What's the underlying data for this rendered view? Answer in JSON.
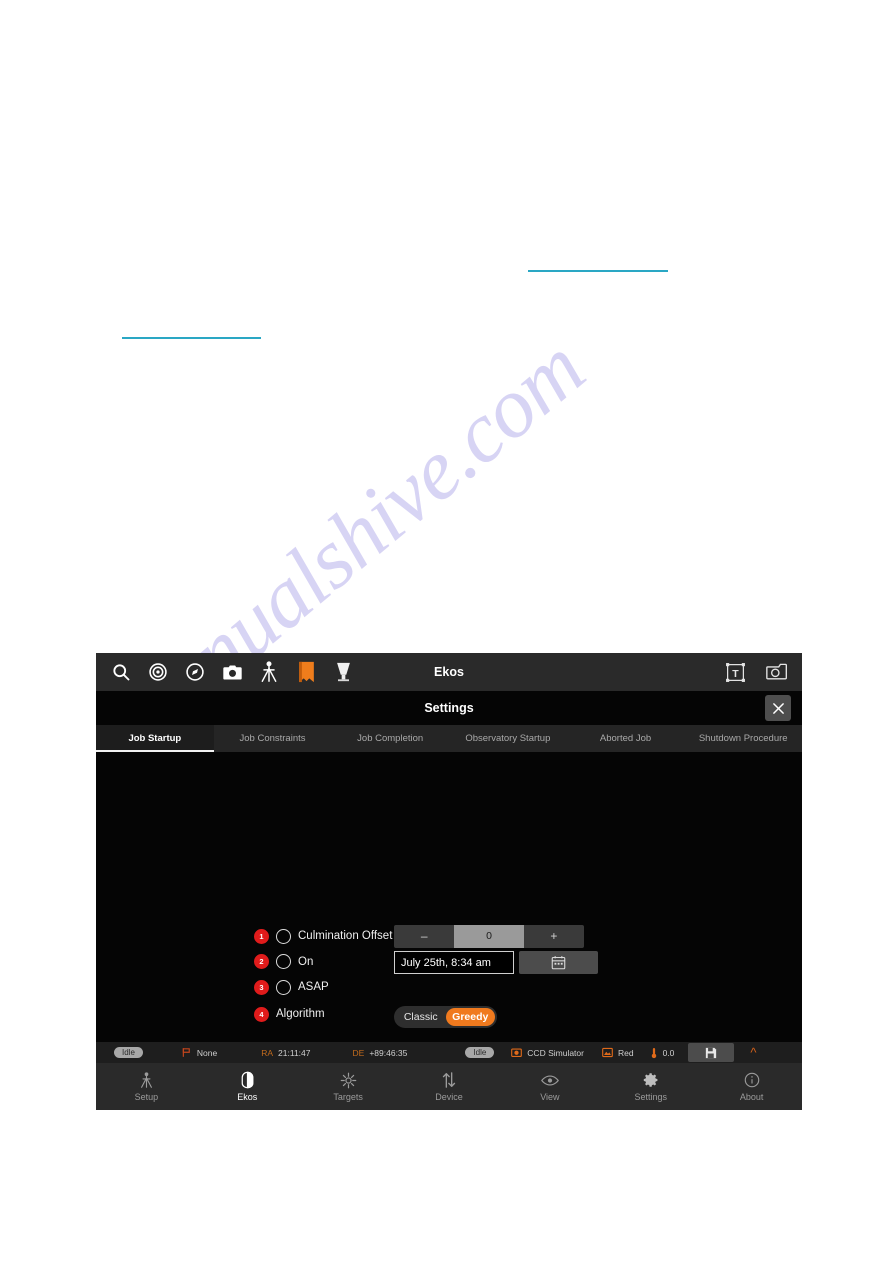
{
  "document": {
    "watermark": "manualshive.com",
    "rules": [
      "",
      ""
    ]
  },
  "toolbar": {
    "title": "Ekos",
    "left_icons": [
      {
        "name": "search-icon"
      },
      {
        "name": "target-icon"
      },
      {
        "name": "compass-icon"
      },
      {
        "name": "camera-icon"
      },
      {
        "name": "telescope-icon"
      },
      {
        "name": "book-icon"
      },
      {
        "name": "cone-icon"
      }
    ],
    "right_icons": [
      {
        "name": "text-frame-icon"
      },
      {
        "name": "screenshot-icon"
      }
    ]
  },
  "settings": {
    "title": "Settings",
    "close_label": "✕"
  },
  "tabs": [
    {
      "label": "Job Startup",
      "active": true
    },
    {
      "label": "Job Constraints",
      "active": false
    },
    {
      "label": "Job Completion",
      "active": false
    },
    {
      "label": "Observatory Startup",
      "active": false
    },
    {
      "label": "Aborted Job",
      "active": false
    },
    {
      "label": "Shutdown Procedure",
      "active": false
    }
  ],
  "form": {
    "rows": [
      {
        "badge": "1",
        "label": "Culmination Offset",
        "has_radio": true
      },
      {
        "badge": "2",
        "label": "On",
        "has_radio": true
      },
      {
        "badge": "3",
        "label": "ASAP",
        "has_radio": true
      },
      {
        "badge": "4",
        "label": "Algorithm",
        "has_radio": false
      }
    ],
    "spinner": {
      "minus": "–",
      "value": "0",
      "plus": "+"
    },
    "date": {
      "value": "July 25th, 8:34 am",
      "calendar_icon": "calendar-icon"
    },
    "algorithm": {
      "classic": "Classic",
      "greedy": "Greedy",
      "selected": "Greedy"
    }
  },
  "statusbar": {
    "mount_status": "Idle",
    "target": "None",
    "ra_label": "RA",
    "ra_value": "21:11:47",
    "de_label": "DE",
    "de_value": "+89:46:35",
    "capture_status": "Idle",
    "camera": "CCD Simulator",
    "filter": "Red",
    "temperature": "0.0",
    "save_icon": "save-icon",
    "expand_icon": "chevron-up-icon"
  },
  "bottomnav": [
    {
      "label": "Setup",
      "icon": "telescope-icon",
      "active": false
    },
    {
      "label": "Ekos",
      "icon": "ekos-icon",
      "active": true
    },
    {
      "label": "Targets",
      "icon": "star-icon",
      "active": false
    },
    {
      "label": "Device",
      "icon": "transfer-icon",
      "active": false
    },
    {
      "label": "View",
      "icon": "eye-icon",
      "active": false
    },
    {
      "label": "Settings",
      "icon": "gear-icon",
      "active": false
    },
    {
      "label": "About",
      "icon": "info-icon",
      "active": false
    }
  ],
  "colors": {
    "accent_orange": "#f07a1e",
    "status_orange": "#c26b1d",
    "badge_red": "#e01b1b",
    "link_teal": "#2aa7c4",
    "panel_black": "#000000"
  }
}
